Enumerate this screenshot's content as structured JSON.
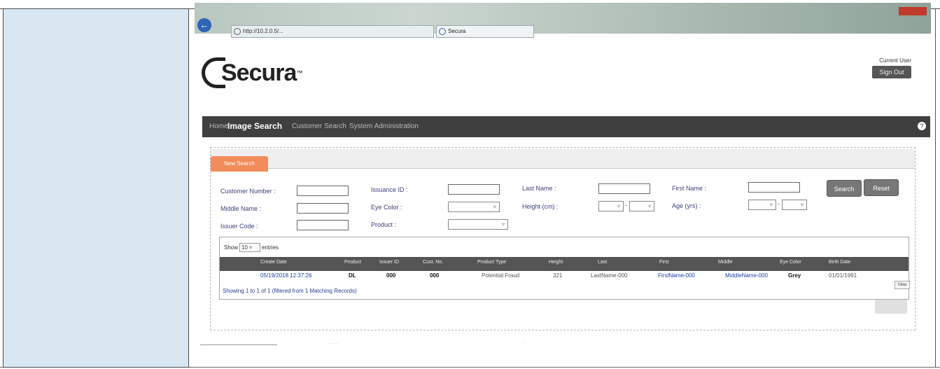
{
  "browser": {
    "address": "http://10.2.0.5/...",
    "tab_title": "Secura"
  },
  "header": {
    "logo_text": "Secura",
    "logo_tm": "™",
    "user_label": "Current User",
    "sign_out": "Sign Out"
  },
  "nav": {
    "items": [
      "Home",
      "Image Search",
      "Customer Search",
      "System Administration"
    ],
    "help": "?"
  },
  "search": {
    "tab_label": "New Search",
    "fields": {
      "customer_number": "Customer Number :",
      "issuance_id": "Issuance ID :",
      "last_name": "Last Name :",
      "first_name": "First Name :",
      "middle_name": "Middle Name :",
      "eye_color": "Eye Color :",
      "height": "Height (cm) :",
      "age": "Age (yrs) :",
      "issuer_code": "Issuer Code :",
      "product": "Product :"
    },
    "dash": "-",
    "search_button": "Search",
    "reset_button": "Reset"
  },
  "results": {
    "show_label": "Show",
    "show_value": "10",
    "entries_label": "entries",
    "columns": [
      "",
      "Create Date",
      "Product",
      "Issuer ID",
      "Cust. No.",
      "Product Type",
      "Height",
      "Last",
      "First",
      "Middle",
      "Eye Color",
      "Birth Date"
    ],
    "row": [
      "",
      "05/19/2018 12:37:26",
      "DL",
      "000",
      "000",
      "Potential Fraud",
      "321",
      "LastName-000",
      "FirstName-000",
      "MiddleName-000",
      "Grey",
      "01/01/1991"
    ],
    "view": "View",
    "showing": "Showing 1 to 1 of 1 (filtered from 1 Matching Records)",
    "export_button": "Export"
  }
}
